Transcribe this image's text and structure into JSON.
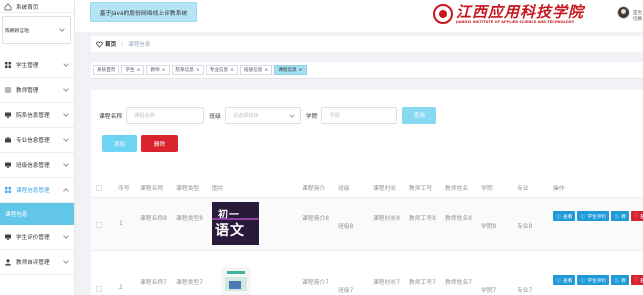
{
  "sidebar": {
    "home": "系统首页",
    "account_select": "陈娜顾言啦",
    "items": [
      {
        "label": "学生管理"
      },
      {
        "label": "教师管理"
      },
      {
        "label": "院系信息管理"
      },
      {
        "label": "专业信息管理"
      },
      {
        "label": "班级信息管理"
      },
      {
        "label": "课程信息管理"
      },
      {
        "label": "学生评价管理"
      },
      {
        "label": "教师自评管理"
      }
    ],
    "sub_active": "课程信息"
  },
  "header": {
    "system_title": "基于Java的股份网络线上评教系统",
    "logo_cn": "江西应用科技学院",
    "logo_en": "JIANGXI INSTITUTE OF APPLIED SCIENCE AND TECHNOLOGY",
    "username": "是否切换"
  },
  "breadcrumb": {
    "home": "首页",
    "current": "课程信息"
  },
  "tabs": [
    {
      "label": "系统首页",
      "closable": false
    },
    {
      "label": "学生",
      "closable": true
    },
    {
      "label": "教师",
      "closable": true
    },
    {
      "label": "院系信息",
      "closable": true
    },
    {
      "label": "专业信息",
      "closable": true
    },
    {
      "label": "班级信息",
      "closable": true
    },
    {
      "label": "课程信息",
      "closable": true,
      "active": true
    }
  ],
  "search": {
    "course_name_label": "课程名称",
    "course_name_placeholder": "课程名称",
    "class_label": "班级",
    "class_placeholder": "请选择班级",
    "college_label": "学院",
    "college_placeholder": "学院",
    "query_button": "查询"
  },
  "actions": {
    "add": "添加",
    "delete": "删除"
  },
  "table": {
    "headers": [
      "序号",
      "课程名称",
      "课程类型",
      "图片",
      "课程简介",
      "班级",
      "课程时长",
      "教师工号",
      "教师姓名",
      "学院",
      "专业",
      "操作"
    ],
    "rows": [
      {
        "index": "1",
        "name": "课程名称8",
        "type": "课程类型8",
        "image": "初一语文",
        "intro": "课程简介8",
        "class": "班级8",
        "duration": "课程时长8",
        "teacher_no": "教师工号8",
        "teacher_name": "教师姓名8",
        "college": "学院8",
        "major": "专业8"
      },
      {
        "index": "2",
        "name": "课程名称7",
        "type": "课程类型7",
        "image": "",
        "intro": "课程简介7",
        "class": "班级7",
        "duration": "课程时长7",
        "teacher_no": "教师工号7",
        "teacher_name": "教师姓名7",
        "college": "学院7",
        "major": "专业7"
      }
    ],
    "row_ops": {
      "view": "查看",
      "student_eval": "学生评价",
      "teacher_eval": "教",
      "delete": "删除"
    }
  },
  "colors": {
    "accent": "#62c6e9",
    "danger": "#d9232d",
    "op_blue": "#1f9ad6"
  }
}
